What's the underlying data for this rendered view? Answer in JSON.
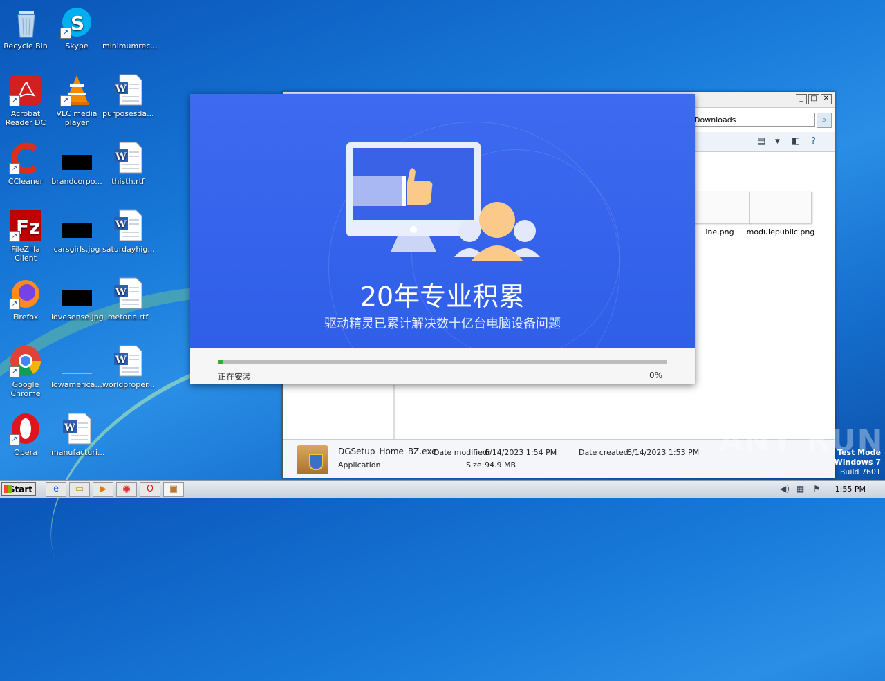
{
  "desktop": {
    "icons": [
      {
        "label": "Recycle Bin",
        "icon": "recycle-bin-icon"
      },
      {
        "label": "Skype",
        "icon": "skype-icon"
      },
      {
        "label": "minimumrec...",
        "icon": "image-file-icon"
      },
      {
        "label": "Acrobat Reader DC",
        "icon": "acrobat-icon"
      },
      {
        "label": "VLC media player",
        "icon": "vlc-icon"
      },
      {
        "label": "purposesda...",
        "icon": "word-doc-icon"
      },
      {
        "label": "CCleaner",
        "icon": "ccleaner-icon"
      },
      {
        "label": "brandcorpo...",
        "icon": "image-file-icon"
      },
      {
        "label": "thisth.rtf",
        "icon": "word-doc-icon"
      },
      {
        "label": "FileZilla Client",
        "icon": "filezilla-icon"
      },
      {
        "label": "carsgirls.jpg",
        "icon": "image-file-icon"
      },
      {
        "label": "saturdayhig...",
        "icon": "word-doc-icon"
      },
      {
        "label": "Firefox",
        "icon": "firefox-icon"
      },
      {
        "label": "lovesense.jpg",
        "icon": "image-file-icon"
      },
      {
        "label": "metone.rtf",
        "icon": "word-doc-icon"
      },
      {
        "label": "Google Chrome",
        "icon": "chrome-icon"
      },
      {
        "label": "lowamerica....",
        "icon": "image-file-icon"
      },
      {
        "label": "worldproper...",
        "icon": "word-doc-icon"
      },
      {
        "label": "Opera",
        "icon": "opera-icon"
      },
      {
        "label": "manufacturi...",
        "icon": "word-doc-icon"
      }
    ]
  },
  "explorer": {
    "address": "Downloads",
    "files": [
      {
        "name": "ine.png"
      },
      {
        "name": "modulepublic.png"
      }
    ],
    "details": {
      "filename": "DGSetup_Home_BZ.exe",
      "type": "Application",
      "modified_label": "Date modified:",
      "modified_value": "6/14/2023 1:54 PM",
      "size_label": "Size:",
      "size_value": "94.9 MB",
      "created_label": "Date created:",
      "created_value": "6/14/2023 1:53 PM"
    }
  },
  "installer": {
    "headline": "20年专业积累",
    "subline": "驱动精灵已累计解决数十亿台电脑设备问题",
    "status": "正在安装",
    "progress_label": "0%",
    "progress_value": 0.01,
    "colors": {
      "banner": "#3d6af0",
      "progress": "#30b030"
    }
  },
  "taskbar": {
    "start_label": "Start",
    "clock": "1:55 PM"
  },
  "watermark": "ANY RUN",
  "testmode": {
    "line1": "Test Mode",
    "line2": "Windows 7",
    "line3": "Build 7601"
  }
}
